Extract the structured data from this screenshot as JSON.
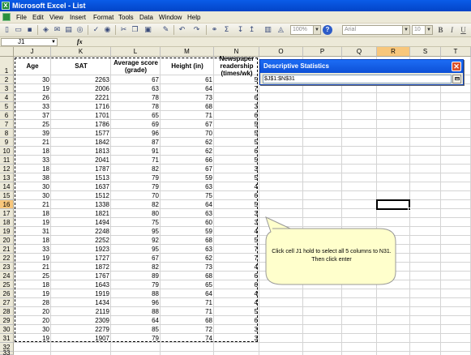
{
  "window": {
    "title": "Microsoft Excel - List",
    "app_icon": "excel-icon"
  },
  "menu": [
    "File",
    "Edit",
    "View",
    "Insert",
    "Format",
    "Tools",
    "Data",
    "Window",
    "Help"
  ],
  "toolbar": {
    "zoom": "100%",
    "font": "Arial",
    "font_size": "10",
    "bold": "B",
    "italic": "I",
    "underline": "U",
    "help": "?"
  },
  "formula_bar": {
    "name_box": "J1",
    "fx": "fx",
    "content": ""
  },
  "sheet": {
    "columns": [
      "J",
      "K",
      "L",
      "M",
      "N",
      "O",
      "P",
      "Q",
      "R",
      "S",
      "T"
    ],
    "rows": [
      "1",
      "2",
      "3",
      "4",
      "5",
      "6",
      "7",
      "8",
      "9",
      "10",
      "11",
      "12",
      "13",
      "14",
      "15",
      "16",
      "17",
      "18",
      "19",
      "20",
      "21",
      "22",
      "23",
      "24",
      "25",
      "26",
      "27",
      "28",
      "29",
      "30",
      "31",
      "32",
      "33"
    ],
    "headers": [
      "Age",
      "SAT",
      "Average score (grade)",
      "Height (in)",
      "Newspaper readership (times/wk)"
    ],
    "data": [
      [
        30,
        2263,
        67,
        61,
        5
      ],
      [
        19,
        2006,
        63,
        64,
        7
      ],
      [
        26,
        2221,
        78,
        73,
        6
      ],
      [
        33,
        1716,
        78,
        68,
        3
      ],
      [
        37,
        1701,
        65,
        71,
        6
      ],
      [
        25,
        1786,
        69,
        67,
        5
      ],
      [
        39,
        1577,
        96,
        70,
        5
      ],
      [
        21,
        1842,
        87,
        62,
        5
      ],
      [
        18,
        1813,
        91,
        62,
        6
      ],
      [
        33,
        2041,
        71,
        66,
        5
      ],
      [
        18,
        1787,
        82,
        67,
        3
      ],
      [
        38,
        1513,
        79,
        59,
        5
      ],
      [
        30,
        1637,
        79,
        63,
        4
      ],
      [
        30,
        1512,
        70,
        75,
        6
      ],
      [
        21,
        1338,
        82,
        64,
        5
      ],
      [
        18,
        1821,
        80,
        63,
        3
      ],
      [
        19,
        1494,
        75,
        60,
        3
      ],
      [
        31,
        2248,
        95,
        59,
        4
      ],
      [
        18,
        2252,
        92,
        68,
        5
      ],
      [
        33,
        1923,
        95,
        63,
        7
      ],
      [
        19,
        1727,
        67,
        62,
        7
      ],
      [
        21,
        1872,
        82,
        73,
        4
      ],
      [
        25,
        1767,
        89,
        68,
        6
      ],
      [
        18,
        1643,
        79,
        65,
        6
      ],
      [
        19,
        1919,
        88,
        64,
        4
      ],
      [
        28,
        1434,
        96,
        71,
        4
      ],
      [
        20,
        2119,
        88,
        71,
        5
      ],
      [
        20,
        2309,
        64,
        68,
        6
      ],
      [
        30,
        2279,
        85,
        72,
        3
      ],
      [
        19,
        1907,
        79,
        74,
        3
      ]
    ],
    "selected_column": "R",
    "selected_row": "16"
  },
  "dialog": {
    "title": "Descriptive Statistics",
    "range_value": "$J$1:$N$31",
    "close_icon": "close-icon",
    "collapse_icon": "collapse-dialog-icon"
  },
  "callout": {
    "text": "Click cell J1 hold to select all 5 columns to N31. Then click enter"
  }
}
